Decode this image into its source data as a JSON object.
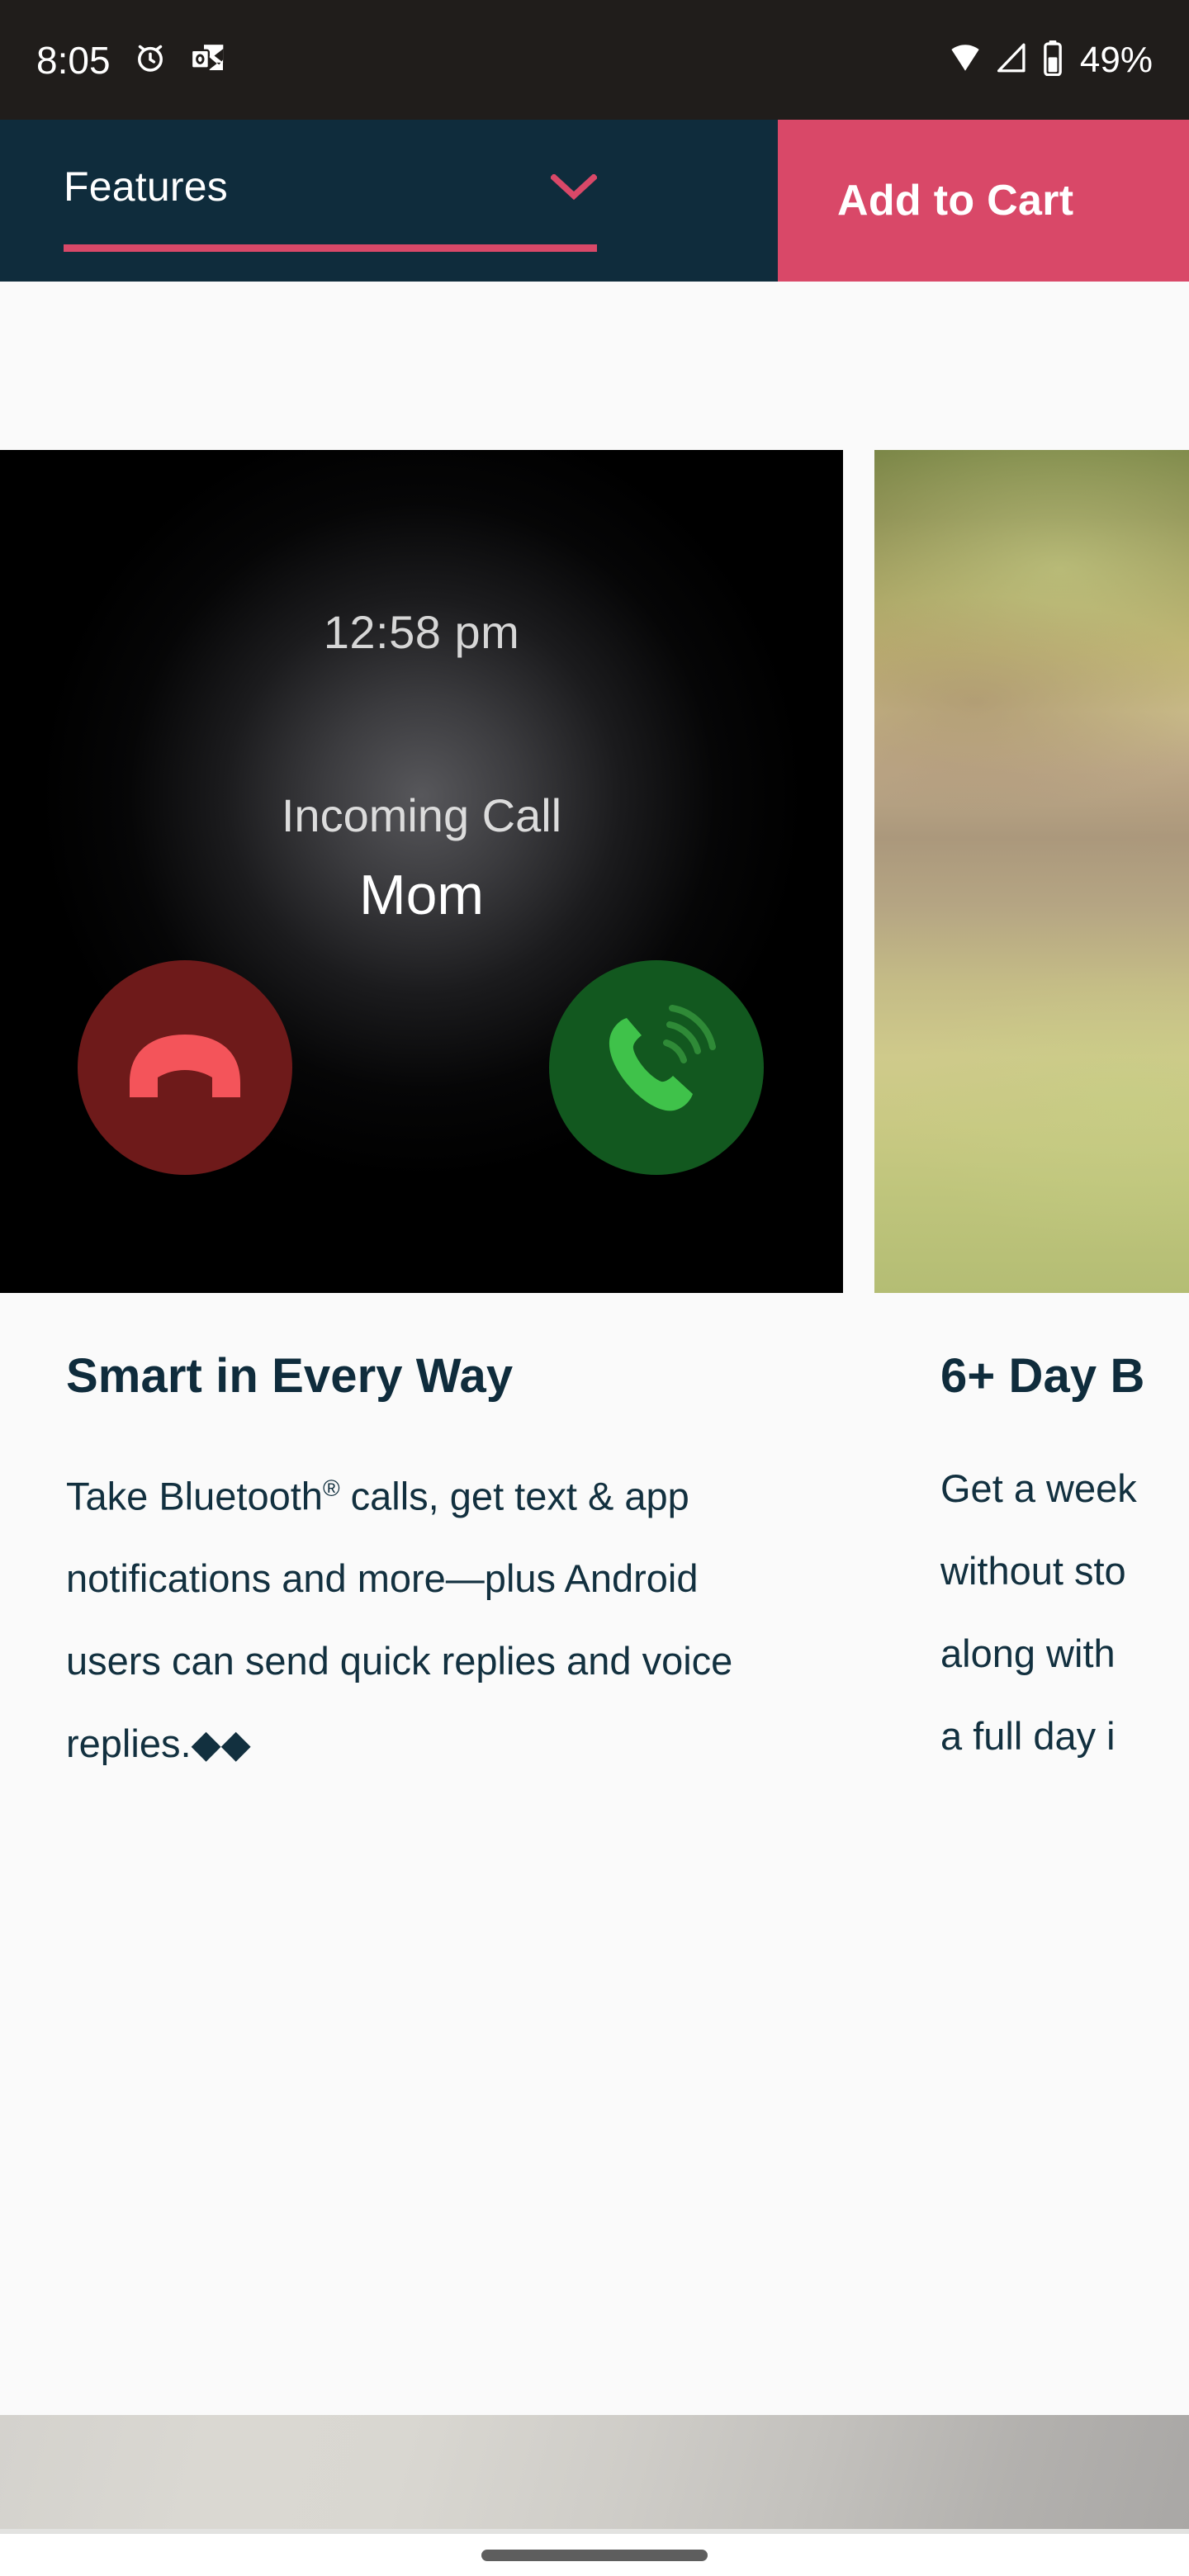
{
  "status_bar": {
    "time": "8:05",
    "battery_percent": "49%",
    "icons": [
      "alarm-clock-icon",
      "outlook-notification-icon",
      "wifi-icon",
      "cellular-signal-icon",
      "battery-icon"
    ]
  },
  "header": {
    "features_label": "Features",
    "features_chevron": "chevron-down-icon",
    "add_to_cart_label": "Add to Cart",
    "navy": "#0f2c3c",
    "accent_pink": "#d94868"
  },
  "carousel": {
    "cards": [
      {
        "media_type": "watch-face-incoming-call",
        "watch": {
          "time": "12:58 pm",
          "status": "Incoming Call",
          "caller": "Mom",
          "decline_icon": "phone-decline-icon",
          "accept_icon": "phone-answer-icon",
          "decline_color": "#6e1a1a",
          "decline_glyph_color": "#f4545a",
          "accept_color": "#12581f",
          "accept_glyph_color": "#3fc24a"
        },
        "title": "Smart in Every Way",
        "body_parts": {
          "before_sup": "Take Bluetooth",
          "sup": "®",
          "after_sup": " calls, get text & app notifications and more—plus Android users can send quick replies and voice replies.",
          "footnote_marks": "◆◆"
        }
      },
      {
        "media_type": "outdoor-photo-person-with-watch",
        "title": "6+ Day B",
        "body": "Get a week\nwithout sto\nalong with\na full day i"
      }
    ]
  },
  "bottom": {
    "nav_pill": "home-indicator"
  }
}
